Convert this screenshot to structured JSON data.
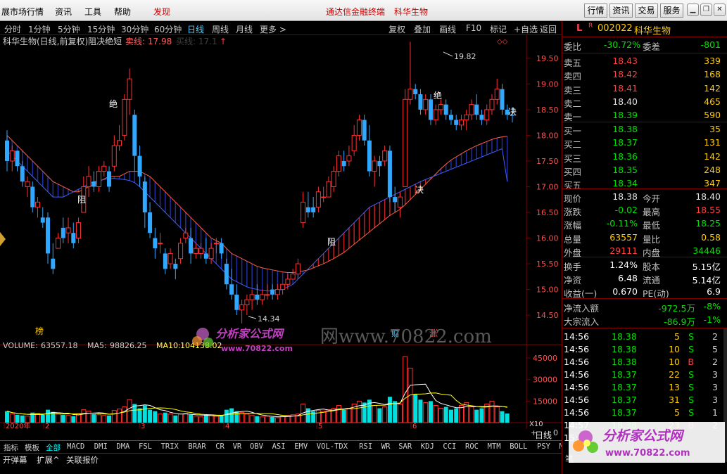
{
  "app": {
    "menu": [
      "展市场行情",
      "资讯",
      "工具",
      "帮助"
    ],
    "alert": "发现",
    "center_title": "通达信金融终端",
    "stock_title": "科华生物",
    "right_buttons": [
      "行情",
      "资讯",
      "交易",
      "服务"
    ]
  },
  "periods": [
    "分时",
    "1分钟",
    "5分钟",
    "15分钟",
    "30分钟",
    "60分钟",
    "日线",
    "周线",
    "月线",
    "更多 >"
  ],
  "period_active": "日线",
  "tools": [
    "复权",
    "叠加",
    "画线",
    "F10",
    "标记",
    "+自选",
    "返回"
  ],
  "chart": {
    "title": "科华生物(日线,前复权)阻决绝短",
    "sell_line": "卖线: 17.98",
    "buy_line": "买线: 17.1",
    "price_axis": [
      "19.50",
      "19.00",
      "18.50",
      "18.00",
      "17.50",
      "17.00",
      "16.50",
      "16.00",
      "15.50",
      "15.00",
      "14.50"
    ],
    "high_label": "19.82",
    "low_label": "14.34",
    "sig": {
      "zu": "阻",
      "jue": "绝",
      "jue2": "决"
    },
    "markers": {
      "bang": "榜",
      "cai": "财",
      "zhang": "涨"
    },
    "vol": {
      "label": "VOLUME:",
      "value": "63557.18",
      "ma5_label": "MA5:",
      "ma5": "98826.25",
      "ma10_label": "MA10:",
      "ma10": "104138.02"
    },
    "vol_axis": [
      "45000",
      "30000",
      "15000"
    ],
    "vol_unit": "X10",
    "x_labels": [
      "2020年",
      "2",
      "3",
      "4",
      "5",
      "6"
    ],
    "footer_label": "日线",
    "footer_tools": [
      "+",
      "-",
      "0"
    ]
  },
  "chart_data": {
    "type": "candlestick",
    "ylim": [
      14.2,
      19.95
    ],
    "candles": [
      [
        17.9,
        18.1,
        17.3,
        17.5
      ],
      [
        17.5,
        17.8,
        17.3,
        17.7
      ],
      [
        17.7,
        17.7,
        17.3,
        17.4
      ],
      [
        17.4,
        17.5,
        17.0,
        17.1
      ],
      [
        17.0,
        17.2,
        16.8,
        17.1
      ],
      [
        17.0,
        17.1,
        16.5,
        16.6
      ],
      [
        16.6,
        16.8,
        16.4,
        16.7
      ],
      [
        16.4,
        16.6,
        16.2,
        16.3
      ],
      [
        16.4,
        16.5,
        15.5,
        15.7
      ],
      [
        15.6,
        15.9,
        15.3,
        15.4
      ],
      [
        15.8,
        16.1,
        15.8,
        16.0
      ],
      [
        16.2,
        16.4,
        15.9,
        16.0
      ],
      [
        16.1,
        16.4,
        15.9,
        16.2
      ],
      [
        16.1,
        16.3,
        15.8,
        15.9
      ],
      [
        16.0,
        16.4,
        15.9,
        16.3
      ],
      [
        16.5,
        17.2,
        16.5,
        17.0
      ],
      [
        17.0,
        17.4,
        16.8,
        17.2
      ],
      [
        17.1,
        17.3,
        16.9,
        17.0
      ],
      [
        17.0,
        17.4,
        16.9,
        17.3
      ],
      [
        17.3,
        17.5,
        17.2,
        17.4
      ],
      [
        17.3,
        17.4,
        16.9,
        17.0
      ],
      [
        17.4,
        18.0,
        17.3,
        17.8
      ],
      [
        17.8,
        18.2,
        17.7,
        17.9
      ],
      [
        18.0,
        18.8,
        17.9,
        18.7
      ],
      [
        18.7,
        19.3,
        18.4,
        19.1
      ],
      [
        18.4,
        18.5,
        17.3,
        17.6
      ],
      [
        17.6,
        17.8,
        17.0,
        17.2
      ],
      [
        17.1,
        17.2,
        16.2,
        16.5
      ],
      [
        16.5,
        16.7,
        16.0,
        16.1
      ],
      [
        16.0,
        16.2,
        15.6,
        15.8
      ],
      [
        15.9,
        16.1,
        15.7,
        15.9
      ],
      [
        15.7,
        15.8,
        15.3,
        15.4
      ],
      [
        15.5,
        15.8,
        15.4,
        15.7
      ],
      [
        15.5,
        15.6,
        15.2,
        15.4
      ],
      [
        15.6,
        16.0,
        15.5,
        15.9
      ],
      [
        16.0,
        16.2,
        15.9,
        16.1
      ],
      [
        16.0,
        16.2,
        15.5,
        15.7
      ],
      [
        15.7,
        15.9,
        15.6,
        15.8
      ],
      [
        15.7,
        15.9,
        15.6,
        15.8
      ],
      [
        15.7,
        16.0,
        15.5,
        15.6
      ],
      [
        15.6,
        15.9,
        15.5,
        15.8
      ],
      [
        15.9,
        16.0,
        15.7,
        15.9
      ],
      [
        15.9,
        16.0,
        15.6,
        15.7
      ],
      [
        15.5,
        15.6,
        15.0,
        15.1
      ],
      [
        15.1,
        15.4,
        14.8,
        14.9
      ],
      [
        14.9,
        15.1,
        14.5,
        14.6
      ],
      [
        14.6,
        14.8,
        14.34,
        14.7
      ],
      [
        14.7,
        14.9,
        14.5,
        14.8
      ],
      [
        14.8,
        15.0,
        14.6,
        14.9
      ],
      [
        14.9,
        15.1,
        14.7,
        14.8
      ],
      [
        14.8,
        15.0,
        14.7,
        14.9
      ],
      [
        14.9,
        15.1,
        14.8,
        14.9
      ],
      [
        15.0,
        15.1,
        14.8,
        14.9
      ],
      [
        14.9,
        15.1,
        14.8,
        15.0
      ],
      [
        15.0,
        15.1,
        14.9,
        15.1
      ],
      [
        15.1,
        15.3,
        15.0,
        15.2
      ],
      [
        15.2,
        15.4,
        15.2,
        15.3
      ],
      [
        15.3,
        15.6,
        15.2,
        15.5
      ],
      [
        16.3,
        16.9,
        16.2,
        16.7
      ],
      [
        16.6,
        16.9,
        16.4,
        16.5
      ],
      [
        16.6,
        16.8,
        16.4,
        16.5
      ],
      [
        16.6,
        17.0,
        16.5,
        16.9
      ],
      [
        16.8,
        17.0,
        16.7,
        16.8
      ],
      [
        16.8,
        17.2,
        16.8,
        17.1
      ],
      [
        17.0,
        17.4,
        16.9,
        17.3
      ],
      [
        17.3,
        17.7,
        17.2,
        17.6
      ],
      [
        17.5,
        17.7,
        17.3,
        17.4
      ],
      [
        17.5,
        17.8,
        17.4,
        17.6
      ],
      [
        17.7,
        18.2,
        17.6,
        18.0
      ],
      [
        18.0,
        18.4,
        17.9,
        18.3
      ],
      [
        18.3,
        18.4,
        17.8,
        17.9
      ],
      [
        17.9,
        18.2,
        17.2,
        17.3
      ],
      [
        17.3,
        17.6,
        17.0,
        17.5
      ],
      [
        17.5,
        17.6,
        17.2,
        17.4
      ],
      [
        17.5,
        17.8,
        17.4,
        17.7
      ],
      [
        17.7,
        17.8,
        16.7,
        16.8
      ],
      [
        16.8,
        17.0,
        16.5,
        16.7
      ],
      [
        16.6,
        16.9,
        16.4,
        16.8
      ],
      [
        17.0,
        18.9,
        17.0,
        18.7
      ],
      [
        18.7,
        19.82,
        18.6,
        18.9
      ],
      [
        18.9,
        19.0,
        18.7,
        18.8
      ],
      [
        18.8,
        18.9,
        18.4,
        18.5
      ],
      [
        18.5,
        18.8,
        18.4,
        18.7
      ],
      [
        18.7,
        18.8,
        18.2,
        18.3
      ],
      [
        18.3,
        18.6,
        18.2,
        18.5
      ],
      [
        18.5,
        18.7,
        18.4,
        18.6
      ],
      [
        18.6,
        18.7,
        18.3,
        18.4
      ],
      [
        18.4,
        18.5,
        18.2,
        18.3
      ],
      [
        18.3,
        18.4,
        18.1,
        18.2
      ],
      [
        18.2,
        18.4,
        18.1,
        18.3
      ],
      [
        18.3,
        18.5,
        18.1,
        18.4
      ],
      [
        18.4,
        18.7,
        18.3,
        18.6
      ],
      [
        18.6,
        18.8,
        18.3,
        18.4
      ],
      [
        18.4,
        18.5,
        18.2,
        18.3
      ],
      [
        18.3,
        18.6,
        18.2,
        18.5
      ],
      [
        18.5,
        18.8,
        18.4,
        18.7
      ],
      [
        18.7,
        19.1,
        18.6,
        18.9
      ],
      [
        18.9,
        19.0,
        18.4,
        18.5
      ],
      [
        18.5,
        18.6,
        18.3,
        18.4
      ],
      [
        18.4,
        18.55,
        18.25,
        18.38
      ]
    ],
    "volume": [
      80000,
      60000,
      55000,
      50000,
      45000,
      70000,
      65000,
      55000,
      90000,
      75000,
      60000,
      55000,
      50000,
      45000,
      60000,
      90000,
      80000,
      60000,
      55000,
      50000,
      50000,
      85000,
      95000,
      110000,
      160000,
      130000,
      100000,
      120000,
      90000,
      80000,
      60000,
      70000,
      60000,
      50000,
      60000,
      65000,
      55000,
      45000,
      40000,
      55000,
      50000,
      45000,
      50000,
      90000,
      100000,
      80000,
      70000,
      60000,
      50000,
      45000,
      40000,
      45000,
      40000,
      35000,
      45000,
      50000,
      55000,
      60000,
      130000,
      100000,
      80000,
      85000,
      80000,
      90000,
      100000,
      120000,
      90000,
      100000,
      130000,
      150000,
      140000,
      160000,
      120000,
      100000,
      110000,
      180000,
      150000,
      130000,
      460000,
      380000,
      200000,
      160000,
      140000,
      150000,
      120000,
      100000,
      110000,
      90000,
      100000,
      120000,
      140000,
      110000,
      90000,
      100000,
      130000,
      150000,
      110000,
      80000,
      63557
    ],
    "ma_sell": [
      18.0,
      17.9,
      17.8,
      17.7,
      17.6,
      17.5,
      17.4,
      17.3,
      17.2,
      17.1,
      17.05,
      17.0,
      16.95,
      16.9,
      16.9,
      16.95,
      17.0,
      17.05,
      17.1,
      17.15,
      17.2,
      17.2,
      17.2,
      17.25,
      17.3,
      17.3,
      17.3,
      17.25,
      17.2,
      17.1,
      17.0,
      16.9,
      16.8,
      16.7,
      16.6,
      16.5,
      16.4,
      16.3,
      16.2,
      16.1,
      16.0,
      15.95,
      15.9,
      15.8,
      15.7,
      15.65,
      15.6,
      15.55,
      15.5,
      15.45,
      15.42,
      15.4,
      15.38,
      15.36,
      15.34,
      15.33,
      15.33,
      15.34,
      15.36,
      15.38,
      15.42,
      15.46,
      15.5,
      15.55,
      15.6,
      15.66,
      15.72,
      15.8,
      15.88,
      15.96,
      16.04,
      16.12,
      16.2,
      16.28,
      16.36,
      16.44,
      16.5,
      16.56,
      16.65,
      16.75,
      16.85,
      16.95,
      17.05,
      17.15,
      17.25,
      17.35,
      17.44,
      17.52,
      17.58,
      17.64,
      17.7,
      17.75,
      17.8,
      17.84,
      17.88,
      17.92,
      17.95,
      17.97,
      17.98
    ],
    "ma_buy": [
      17.7,
      17.6,
      17.5,
      17.4,
      17.3,
      17.2,
      17.1,
      17.0,
      16.9,
      16.8,
      16.8,
      16.8,
      16.85,
      16.9,
      16.95,
      17.0,
      17.05,
      17.1,
      17.12,
      17.14,
      17.16,
      17.16,
      17.15,
      17.14,
      17.12,
      17.08,
      17.0,
      16.9,
      16.8,
      16.7,
      16.6,
      16.5,
      16.4,
      16.3,
      16.2,
      16.1,
      16.0,
      15.9,
      15.8,
      15.7,
      15.6,
      15.5,
      15.4,
      15.3,
      15.2,
      15.15,
      15.1,
      15.05,
      15.02,
      15.0,
      14.98,
      14.97,
      14.97,
      14.98,
      15.0,
      15.05,
      15.1,
      15.2,
      15.3,
      15.4,
      15.5,
      15.6,
      15.7,
      15.8,
      15.9,
      16.0,
      16.1,
      16.2,
      16.3,
      16.4,
      16.5,
      16.6,
      16.65,
      16.7,
      16.75,
      16.8,
      16.85,
      16.9,
      16.95,
      17.0,
      17.05,
      17.1,
      17.14,
      17.18,
      17.22,
      17.26,
      17.3,
      17.34,
      17.38,
      17.42,
      17.46,
      17.5,
      17.54,
      17.58,
      17.62,
      17.66,
      17.7,
      17.74,
      17.1
    ]
  },
  "tabs": [
    "指标",
    "模板",
    "全部",
    "MACD",
    "DMI",
    "DMA",
    "FSL",
    "TRIX",
    "BRAR",
    "CR",
    "VR",
    "OBV",
    "ASI",
    "EMV",
    "VOL-TDX",
    "RSI",
    "WR",
    "SAR",
    "KDJ",
    "CCI",
    "ROC",
    "MTM",
    "BOLL",
    "PSY",
    "MCST"
  ],
  "tab_active": "全部",
  "bottom": [
    "开弹幕",
    "扩展^",
    "关联报价"
  ],
  "panel": {
    "flag": "L",
    "r": "R",
    "code": "002022",
    "name": "科华生物",
    "weibi_label": "委比",
    "weibi": "-30.72%",
    "weicha_label": "委差",
    "weicha": "-801",
    "sells": [
      [
        "卖五",
        "18.43",
        "339"
      ],
      [
        "卖四",
        "18.42",
        "168"
      ],
      [
        "卖三",
        "18.41",
        "142"
      ],
      [
        "卖二",
        "18.40",
        "465"
      ],
      [
        "卖一",
        "18.39",
        "590"
      ]
    ],
    "buys": [
      [
        "买一",
        "18.38",
        "35"
      ],
      [
        "买二",
        "18.37",
        "131"
      ],
      [
        "买三",
        "18.36",
        "142"
      ],
      [
        "买四",
        "18.35",
        "248"
      ],
      [
        "买五",
        "18.34",
        "347"
      ]
    ],
    "quote": [
      [
        "现价",
        "18.38",
        "今开",
        "18.40"
      ],
      [
        "涨跌",
        "-0.02",
        "最高",
        "18.55"
      ],
      [
        "涨幅",
        "-0.11%",
        "最低",
        "18.25"
      ],
      [
        "总量",
        "63557",
        "量比",
        "0.58"
      ],
      [
        "外盘",
        "29111",
        "内盘",
        "34446"
      ]
    ],
    "fin": [
      [
        "换手",
        "1.24%",
        "股本",
        "5.15亿"
      ],
      [
        "净资",
        "6.48",
        "流通",
        "5.14亿"
      ],
      [
        "收益(一)",
        "0.670",
        "PE(动)",
        "6.9"
      ]
    ],
    "flow": [
      [
        "净流入额",
        "-972.5万",
        "-8%"
      ],
      [
        "大宗流入",
        "-86.9万",
        "-1%"
      ]
    ],
    "ticks": [
      [
        "14:56",
        "18.38",
        "5",
        "S",
        "2"
      ],
      [
        "14:56",
        "18.38",
        "10",
        "S",
        "5"
      ],
      [
        "14:56",
        "18.38",
        "10",
        "B",
        "2"
      ],
      [
        "14:56",
        "18.37",
        "22",
        "S",
        "3"
      ],
      [
        "14:56",
        "18.37",
        "13",
        "S",
        "3"
      ],
      [
        "14:56",
        "18.37",
        "31",
        "S",
        "3"
      ],
      [
        "14:56",
        "18.37",
        "5",
        "S",
        "1"
      ],
      [
        "14:57",
        "18.38",
        "23",
        "B",
        "2"
      ],
      [
        "15:",
        "",
        "",
        "",
        ""
      ]
    ],
    "side_label": "笔"
  },
  "watermark": {
    "text1": "分析家公式网",
    "text2": "www.70822.com",
    "url_big": "www.70822.com",
    "wangtext": "网"
  }
}
